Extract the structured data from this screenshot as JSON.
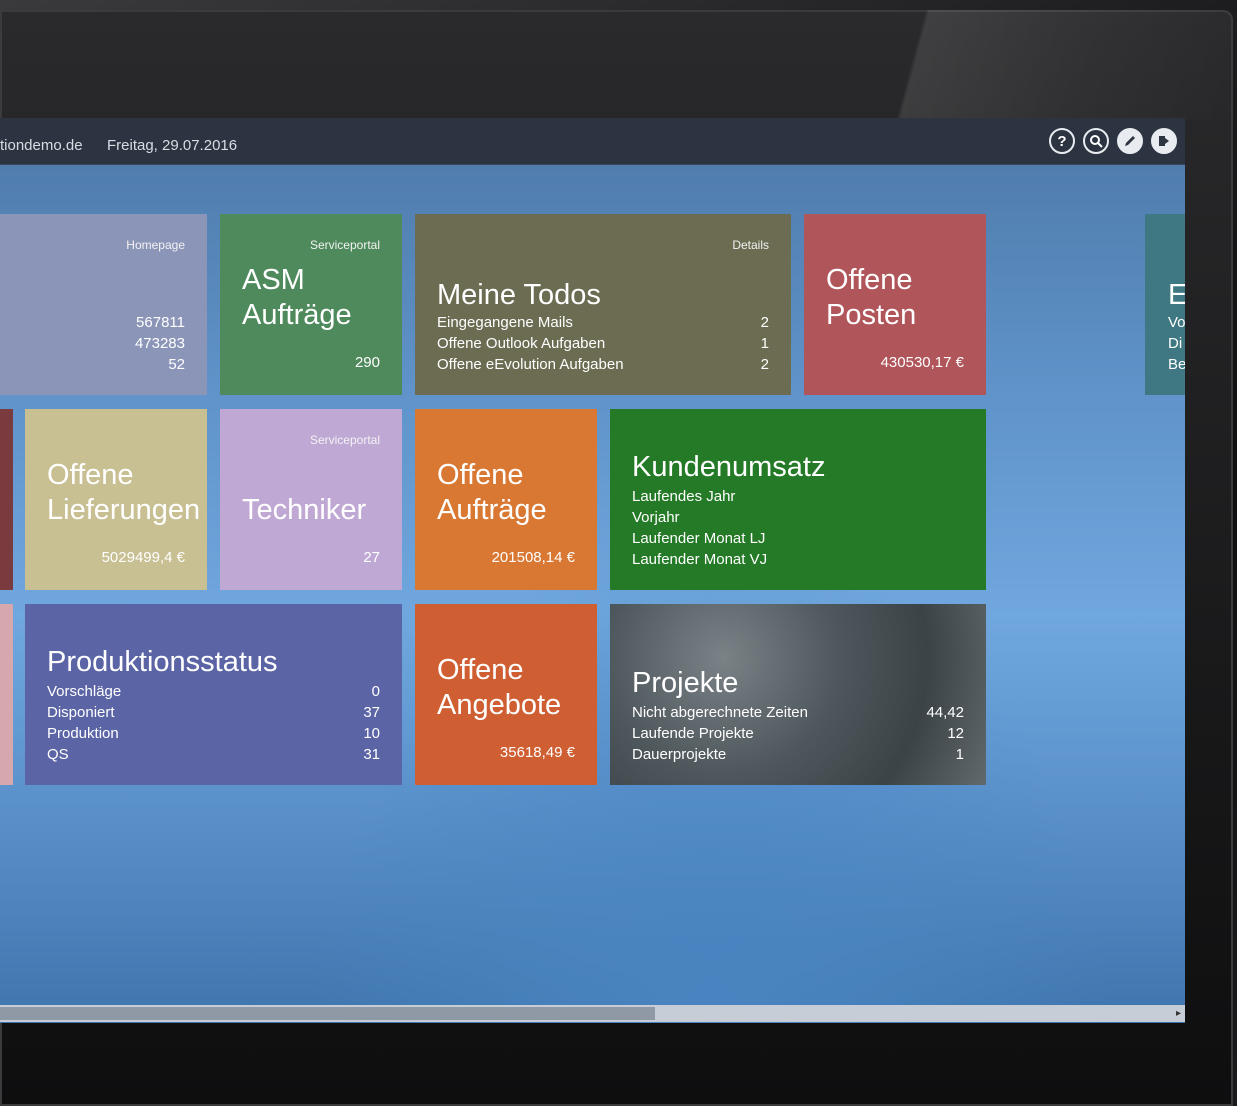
{
  "topbar": {
    "domain": "tiondemo.de",
    "date": "Freitag, 29.07.2016",
    "icons": [
      "help-icon",
      "search-icon",
      "edit-icon",
      "logout-icon"
    ]
  },
  "tiles": {
    "partial_top": {
      "link": "Homepage",
      "values": [
        "567811",
        "473283",
        "52"
      ],
      "color": "#8b95b8"
    },
    "asm": {
      "link": "Serviceportal",
      "title1": "ASM",
      "title2": "Aufträge",
      "value": "290",
      "color": "#4f8a5c"
    },
    "todos": {
      "link": "Details",
      "title": "Meine Todos",
      "rows": [
        {
          "label": "Eingegangene Mails",
          "value": "2"
        },
        {
          "label": "Offene Outlook Aufgaben",
          "value": "1"
        },
        {
          "label": "Offene eEvolution Aufgaben",
          "value": "2"
        }
      ],
      "color": "#6b6c52"
    },
    "posten": {
      "title1": "Offene",
      "title2": "Posten",
      "value": "430530,17 €",
      "color": "#b0555a"
    },
    "far_right": {
      "title": "E",
      "rows": [
        "Vo",
        "Di",
        "Be"
      ],
      "color": "#3f7882"
    },
    "lieferungen": {
      "title1": "Offene",
      "title2": "Lieferungen",
      "value": "5029499,4 €",
      "color": "#c8bf93"
    },
    "techniker": {
      "link": "Serviceportal",
      "title": "Techniker",
      "value": "27",
      "color": "#c0a8d4"
    },
    "auftraege": {
      "title1": "Offene",
      "title2": "Aufträge",
      "value": "201508,14 €",
      "color": "#d97832"
    },
    "kundenumsatz": {
      "title": "Kundenumsatz",
      "rows": [
        "Laufendes Jahr",
        "Vorjahr",
        "Laufender Monat LJ",
        "Laufender Monat VJ"
      ],
      "color": "#247a26"
    },
    "produktion": {
      "title": "Produktionsstatus",
      "rows": [
        {
          "label": "Vorschläge",
          "value": "0"
        },
        {
          "label": "Disponiert",
          "value": "37"
        },
        {
          "label": "Produktion",
          "value": "10"
        },
        {
          "label": "QS",
          "value": "31"
        }
      ],
      "color": "#5b65a6"
    },
    "angebote": {
      "title1": "Offene",
      "title2": "Angebote",
      "value": "35618,49 €",
      "color": "#cf5f32"
    },
    "projekte": {
      "title": "Projekte",
      "rows": [
        {
          "label": "Nicht abgerechnete Zeiten",
          "value": "44,42"
        },
        {
          "label": "Laufende Projekte",
          "value": "12"
        },
        {
          "label": "Dauerprojekte",
          "value": "1"
        }
      ],
      "color": "#5b6468"
    },
    "partial_left_mid": {
      "color": "#7a3b3e"
    },
    "partial_left_bottom": {
      "color": "#d6a7ac"
    }
  }
}
